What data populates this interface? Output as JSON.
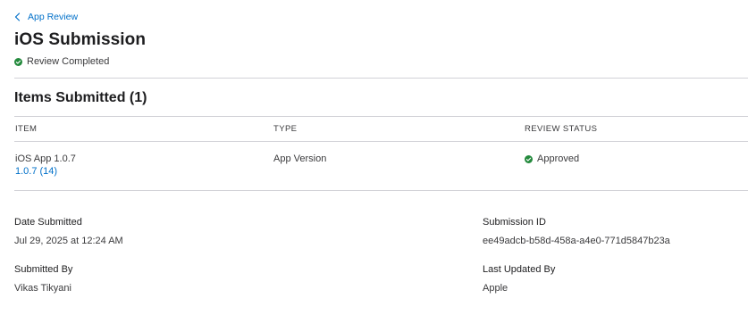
{
  "nav": {
    "back_label": "App Review"
  },
  "page": {
    "title": "iOS Submission",
    "status": "Review Completed",
    "status_color": "#248a3d"
  },
  "items": {
    "heading": "Items Submitted (1)",
    "columns": {
      "item": "ITEM",
      "type": "TYPE",
      "review_status": "REVIEW STATUS"
    },
    "rows": [
      {
        "item_name": "iOS App 1.0.7",
        "build_link": "1.0.7 (14)",
        "type": "App Version",
        "review_status": "Approved"
      }
    ]
  },
  "details": {
    "date_submitted_label": "Date Submitted",
    "date_submitted": "Jul 29, 2025 at 12:24 AM",
    "submission_id_label": "Submission ID",
    "submission_id": "ee49adcb-b58d-458a-a4e0-771d5847b23a",
    "submitted_by_label": "Submitted By",
    "submitted_by": "Vikas Tikyani",
    "last_updated_by_label": "Last Updated By",
    "last_updated_by": "Apple"
  },
  "colors": {
    "accent": "#0070c9",
    "success": "#248a3d",
    "divider": "#d2d2d7"
  },
  "icons": {
    "back": "chevron-left-icon",
    "status": "check-circle-icon"
  }
}
